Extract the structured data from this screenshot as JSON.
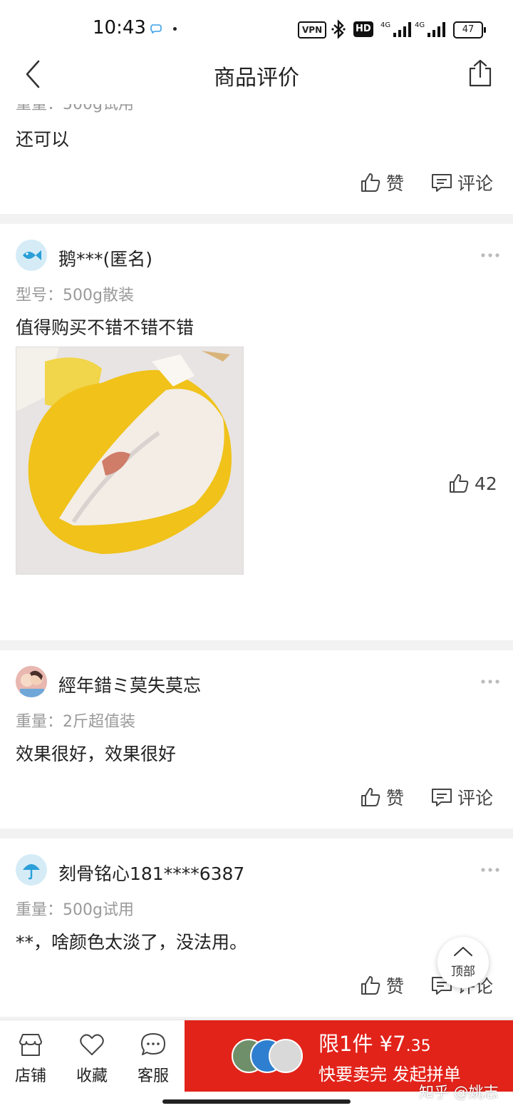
{
  "status_bar": {
    "time": "10:43",
    "vpn": "VPN",
    "hd": "HD",
    "net1": "4G",
    "net2": "4G",
    "battery": "47"
  },
  "header": {
    "title": "商品评价"
  },
  "cut_review": {
    "spec": "重量：500g试用",
    "text": "还可以",
    "like_label": "赞",
    "comment_label": "评论"
  },
  "reviews": [
    {
      "user": "鹅***(匿名)",
      "spec": "型号：500g散装",
      "text": "值得购买不错不错不错",
      "like_count": "42"
    },
    {
      "user": "經年錯ミ莫失莫忘",
      "spec": "重量：2斤超值装",
      "text": "效果很好，效果很好",
      "like_label": "赞",
      "comment_label": "评论"
    },
    {
      "user": "刻骨铭心181****6387",
      "spec": "重量：500g试用",
      "text": "**，啥颜色太淡了，没法用。",
      "like_label": "赞",
      "comment_label": "评论"
    }
  ],
  "scroll_top": {
    "label": "顶部"
  },
  "bottom_bar": {
    "tabs": [
      {
        "label": "店铺",
        "icon": "shop-icon"
      },
      {
        "label": "收藏",
        "icon": "heart-icon"
      },
      {
        "label": "客服",
        "icon": "chat-icon"
      }
    ],
    "buy": {
      "price_prefix": "限1件 ¥7",
      "price_cents": ".35",
      "subtitle": "快要卖完 发起拼单"
    }
  },
  "watermark": "知乎 @姚志",
  "colors": {
    "accent_red": "#e2231a",
    "divider": "#f2f2f2",
    "spec_gray": "#9a9a9a"
  }
}
